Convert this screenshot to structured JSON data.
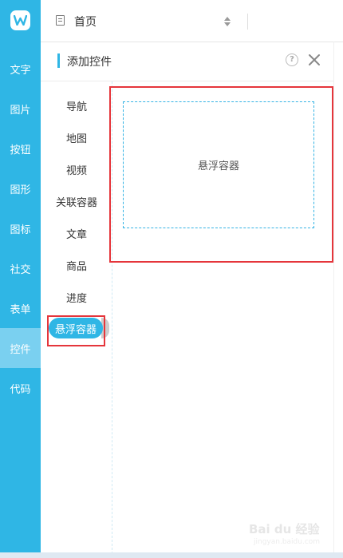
{
  "sidebar": {
    "logo_letter": "W",
    "items": [
      {
        "label": "文字"
      },
      {
        "label": "图片"
      },
      {
        "label": "按钮"
      },
      {
        "label": "图形"
      },
      {
        "label": "图标"
      },
      {
        "label": "社交"
      },
      {
        "label": "表单"
      },
      {
        "label": "控件",
        "active": true
      },
      {
        "label": "代码"
      }
    ]
  },
  "topbar": {
    "page_name": "首页"
  },
  "panel": {
    "title": "添加控件",
    "help_glyph": "?"
  },
  "categories": [
    {
      "label": "导航"
    },
    {
      "label": "地图"
    },
    {
      "label": "视频"
    },
    {
      "label": "关联容器"
    },
    {
      "label": "文章"
    },
    {
      "label": "商品"
    },
    {
      "label": "进度"
    },
    {
      "label": "悬浮容器",
      "selected": true
    }
  ],
  "widget": {
    "label": "悬浮容器"
  },
  "watermark": {
    "text": "Bai du 经验",
    "sub": "jingyan.baidu.com"
  },
  "colors": {
    "accent": "#2fb6e5",
    "highlight": "#e5353b",
    "active_nav": "#7ad0f0"
  }
}
